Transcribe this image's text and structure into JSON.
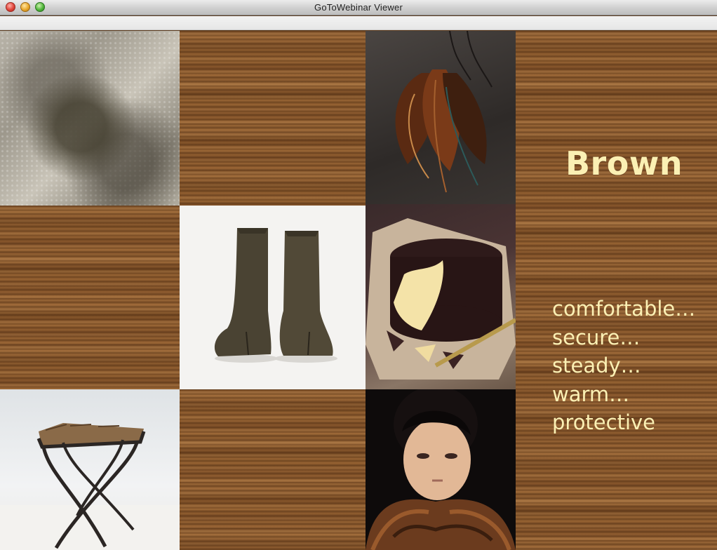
{
  "window": {
    "title": "GoToWebinar Viewer"
  },
  "slide": {
    "heading": "Brown",
    "words": [
      "comfortable…",
      "secure…",
      "steady…",
      "warm…",
      "protective"
    ]
  },
  "colors": {
    "text": "#fbf0b4",
    "wood": "#8f5e32"
  }
}
